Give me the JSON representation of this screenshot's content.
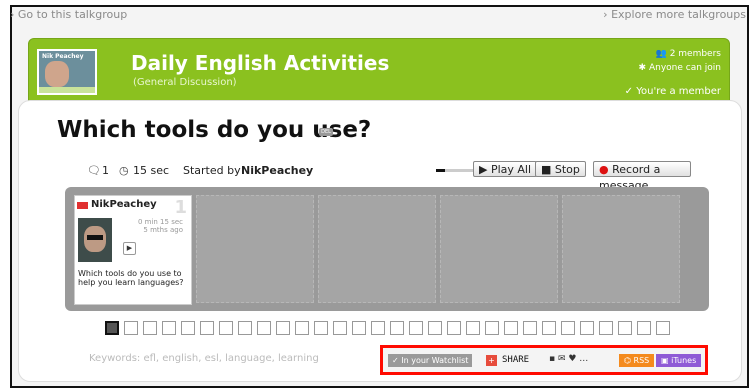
{
  "nav": {
    "left": "› Go to this talkgroup",
    "right": "› Explore more talkgroups"
  },
  "group": {
    "thumb_caption": "Nik Peachey",
    "title": "Daily English Activities",
    "subtitle": "(General Discussion)",
    "members": "2 members",
    "join": "Anyone can join",
    "membership": "You're a member"
  },
  "discussion": {
    "title": "Which tools do you use?",
    "badge": "DEL",
    "comments": "1",
    "duration": "15 sec",
    "started_by_prefix": "Started by",
    "started_by": "NikPeachey",
    "progress_fraction": 0.15,
    "play_all": "Play All",
    "stop": "Stop",
    "record": "Record a message"
  },
  "message": {
    "author": "NikPeachey",
    "number": "1",
    "duration": "0 min 15 sec",
    "ago": "5 mths ago",
    "text": "Which tools do you use to help you learn languages?"
  },
  "keywords": "Keywords: efl, english, esl, language, learning",
  "share": {
    "watchlist": "In your Watchlist",
    "share": "SHARE",
    "rss": "RSS",
    "itunes": "iTunes"
  }
}
